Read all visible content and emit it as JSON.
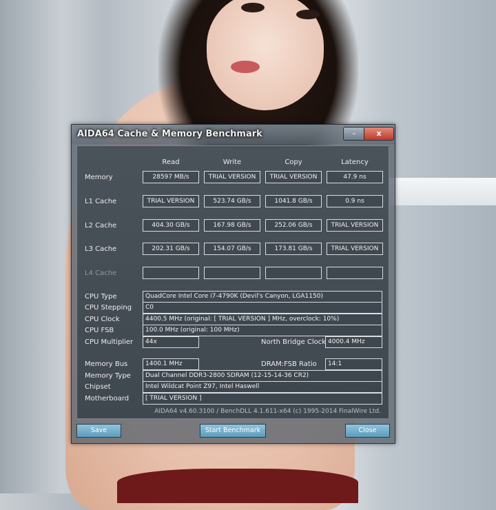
{
  "window": {
    "title": "AIDA64 Cache & Memory Benchmark"
  },
  "columns": [
    "Read",
    "Write",
    "Copy",
    "Latency"
  ],
  "rows": [
    {
      "label": "Memory",
      "values": [
        "28597 MB/s",
        "TRIAL VERSION",
        "TRIAL VERSION",
        "47.9 ns"
      ]
    },
    {
      "label": "L1 Cache",
      "values": [
        "TRIAL VERSION",
        "523.74 GB/s",
        "1041.8 GB/s",
        "0.9 ns"
      ]
    },
    {
      "label": "L2 Cache",
      "values": [
        "404.30 GB/s",
        "167.98 GB/s",
        "252.06 GB/s",
        "TRIAL VERSION"
      ]
    },
    {
      "label": "L3 Cache",
      "values": [
        "202.31 GB/s",
        "154.07 GB/s",
        "173.81 GB/s",
        "TRIAL VERSION"
      ]
    },
    {
      "label": "L4 Cache",
      "values": [
        "",
        "",
        "",
        ""
      ]
    }
  ],
  "info": {
    "cpu_type_label": "CPU Type",
    "cpu_type": "QuadCore Intel Core i7-4790K  (Devil's Canyon, LGA1150)",
    "cpu_stepping_label": "CPU Stepping",
    "cpu_stepping": "C0",
    "cpu_clock_label": "CPU Clock",
    "cpu_clock": "4400.5 MHz  (original: [ TRIAL VERSION ] MHz, overclock: 10%)",
    "cpu_fsb_label": "CPU FSB",
    "cpu_fsb": "100.0 MHz  (original: 100 MHz)",
    "cpu_multiplier_label": "CPU Multiplier",
    "cpu_multiplier": "44x",
    "north_bridge_label": "North Bridge Clock",
    "north_bridge": "4000.4 MHz",
    "memory_bus_label": "Memory Bus",
    "memory_bus": "1400.1 MHz",
    "dram_fsb_label": "DRAM:FSB Ratio",
    "dram_fsb": "14:1",
    "memory_type_label": "Memory Type",
    "memory_type": "Dual Channel DDR3-2800 SDRAM  (12-15-14-36 CR2)",
    "chipset_label": "Chipset",
    "chipset": "Intel Wildcat Point Z97, Intel Haswell",
    "motherboard_label": "Motherboard",
    "motherboard": "[ TRIAL VERSION ]"
  },
  "footer": "AIDA64 v4.60.3100 / BenchDLL 4.1.611-x64  (c) 1995-2014 FinalWire Ltd.",
  "buttons": {
    "save": "Save",
    "start": "Start Benchmark",
    "close": "Close"
  },
  "titlebar_buttons": {
    "minimize": "–",
    "close": "x"
  }
}
